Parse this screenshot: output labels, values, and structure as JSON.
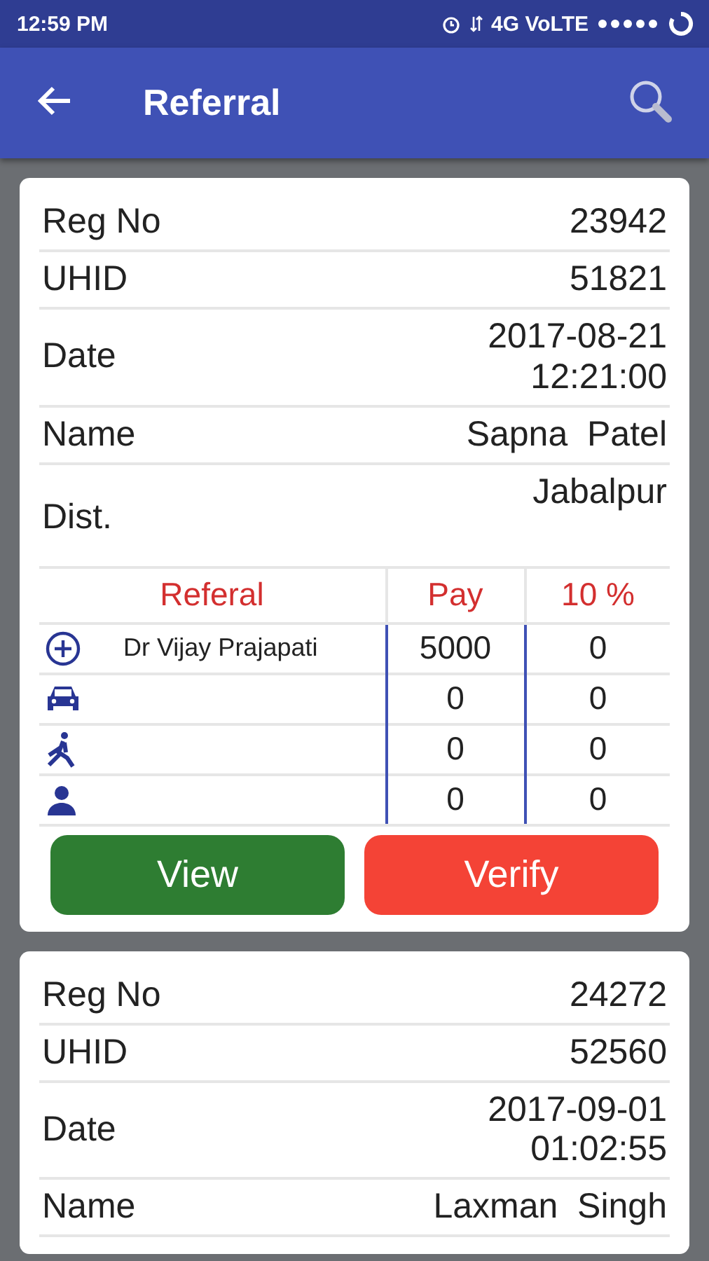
{
  "status_bar": {
    "time": "12:59 PM",
    "network": "4G VoLTE"
  },
  "app_bar": {
    "title": "Referral"
  },
  "cards": [
    {
      "fields": [
        {
          "label": "Reg No",
          "lines": [
            "23942"
          ]
        },
        {
          "label": "UHID",
          "lines": [
            "51821"
          ]
        },
        {
          "label": "Date",
          "lines": [
            "2017-08-21",
            "12:21:00"
          ]
        },
        {
          "label": "Name",
          "lines": [
            "Sapna  Patel"
          ]
        },
        {
          "label": "Dist.",
          "lines": [
            "Jabalpur"
          ],
          "kind": "top"
        }
      ],
      "referrals": {
        "columns": [
          "Referal",
          "Pay",
          "10 %"
        ],
        "rows": [
          {
            "kind": "doctor",
            "name": "Dr Vijay Prajapati",
            "pay": "5000",
            "percent": "0"
          },
          {
            "kind": "car",
            "pay": "0",
            "percent": "0"
          },
          {
            "kind": "walker",
            "pay": "0",
            "percent": "0"
          },
          {
            "kind": "person",
            "pay": "0",
            "percent": "0"
          }
        ]
      },
      "buttons": [
        {
          "label": "View",
          "kind": "view"
        },
        {
          "label": "Verify",
          "kind": "verify"
        }
      ]
    },
    {
      "fields": [
        {
          "label": "Reg No",
          "lines": [
            "24272"
          ]
        },
        {
          "label": "UHID",
          "lines": [
            "52560"
          ]
        },
        {
          "label": "Date",
          "lines": [
            "2017-09-01",
            "01:02:55"
          ]
        },
        {
          "label": "Name",
          "lines": [
            "Laxman  Singh"
          ]
        }
      ]
    }
  ]
}
